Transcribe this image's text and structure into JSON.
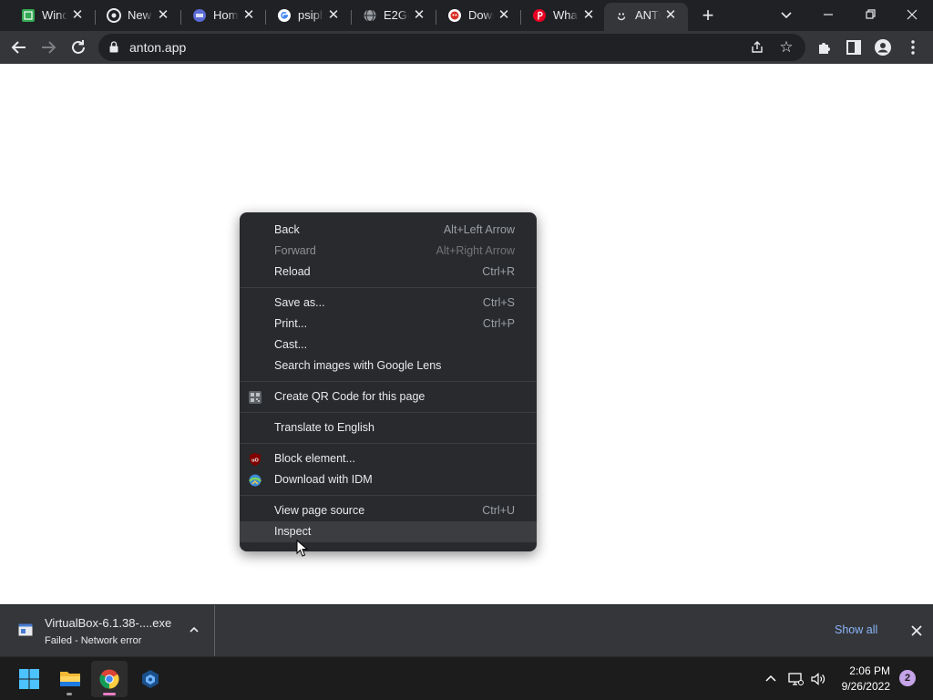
{
  "browser": {
    "tabs": [
      {
        "title": "Windo",
        "icon": "green-sheet-icon",
        "color": "#34a853"
      },
      {
        "title": "New T",
        "icon": "chrome-icon",
        "color": "#e8eaed"
      },
      {
        "title": "Home",
        "icon": "blue-logo-icon",
        "color": "#5b6bd6"
      },
      {
        "title": "psiph",
        "icon": "google-icon",
        "color": "#4285f4"
      },
      {
        "title": "E2Gui",
        "icon": "globe-icon",
        "color": "#9aa0a6"
      },
      {
        "title": "Down",
        "icon": "red-robot-icon",
        "color": "#d93025"
      },
      {
        "title": "What",
        "icon": "pinterest-icon",
        "color": "#e60023"
      },
      {
        "title": "ANTO",
        "icon": "smiley-icon",
        "color": "#e8eaed",
        "active": true
      }
    ],
    "close_glyph": "✕",
    "new_tab_glyph": "+",
    "address": "anton.app"
  },
  "context_menu": {
    "groups": [
      [
        {
          "label": "Back",
          "shortcut": "Alt+Left Arrow"
        },
        {
          "label": "Forward",
          "shortcut": "Alt+Right Arrow",
          "disabled": true
        },
        {
          "label": "Reload",
          "shortcut": "Ctrl+R"
        }
      ],
      [
        {
          "label": "Save as...",
          "shortcut": "Ctrl+S"
        },
        {
          "label": "Print...",
          "shortcut": "Ctrl+P"
        },
        {
          "label": "Cast...",
          "shortcut": ""
        },
        {
          "label": "Search images with Google Lens",
          "shortcut": ""
        }
      ],
      [
        {
          "label": "Create QR Code for this page",
          "shortcut": "",
          "icon": "qr-code-icon"
        }
      ],
      [
        {
          "label": "Translate to English",
          "shortcut": ""
        }
      ],
      [
        {
          "label": "Block element...",
          "shortcut": "",
          "icon": "ublock-icon"
        },
        {
          "label": "Download with IDM",
          "shortcut": "",
          "icon": "idm-icon"
        }
      ],
      [
        {
          "label": "View page source",
          "shortcut": "Ctrl+U"
        },
        {
          "label": "Inspect",
          "shortcut": "",
          "hover": true
        }
      ]
    ]
  },
  "download_shelf": {
    "file_name": "VirtualBox-6.1.38-....exe",
    "status": "Failed - Network error",
    "show_all": "Show all"
  },
  "taskbar": {
    "apps": [
      "windows-start-icon",
      "file-explorer-icon",
      "chrome-icon",
      "virtualbox-icon"
    ],
    "time": "2:06 PM",
    "date": "9/26/2022",
    "notifications": "2"
  }
}
